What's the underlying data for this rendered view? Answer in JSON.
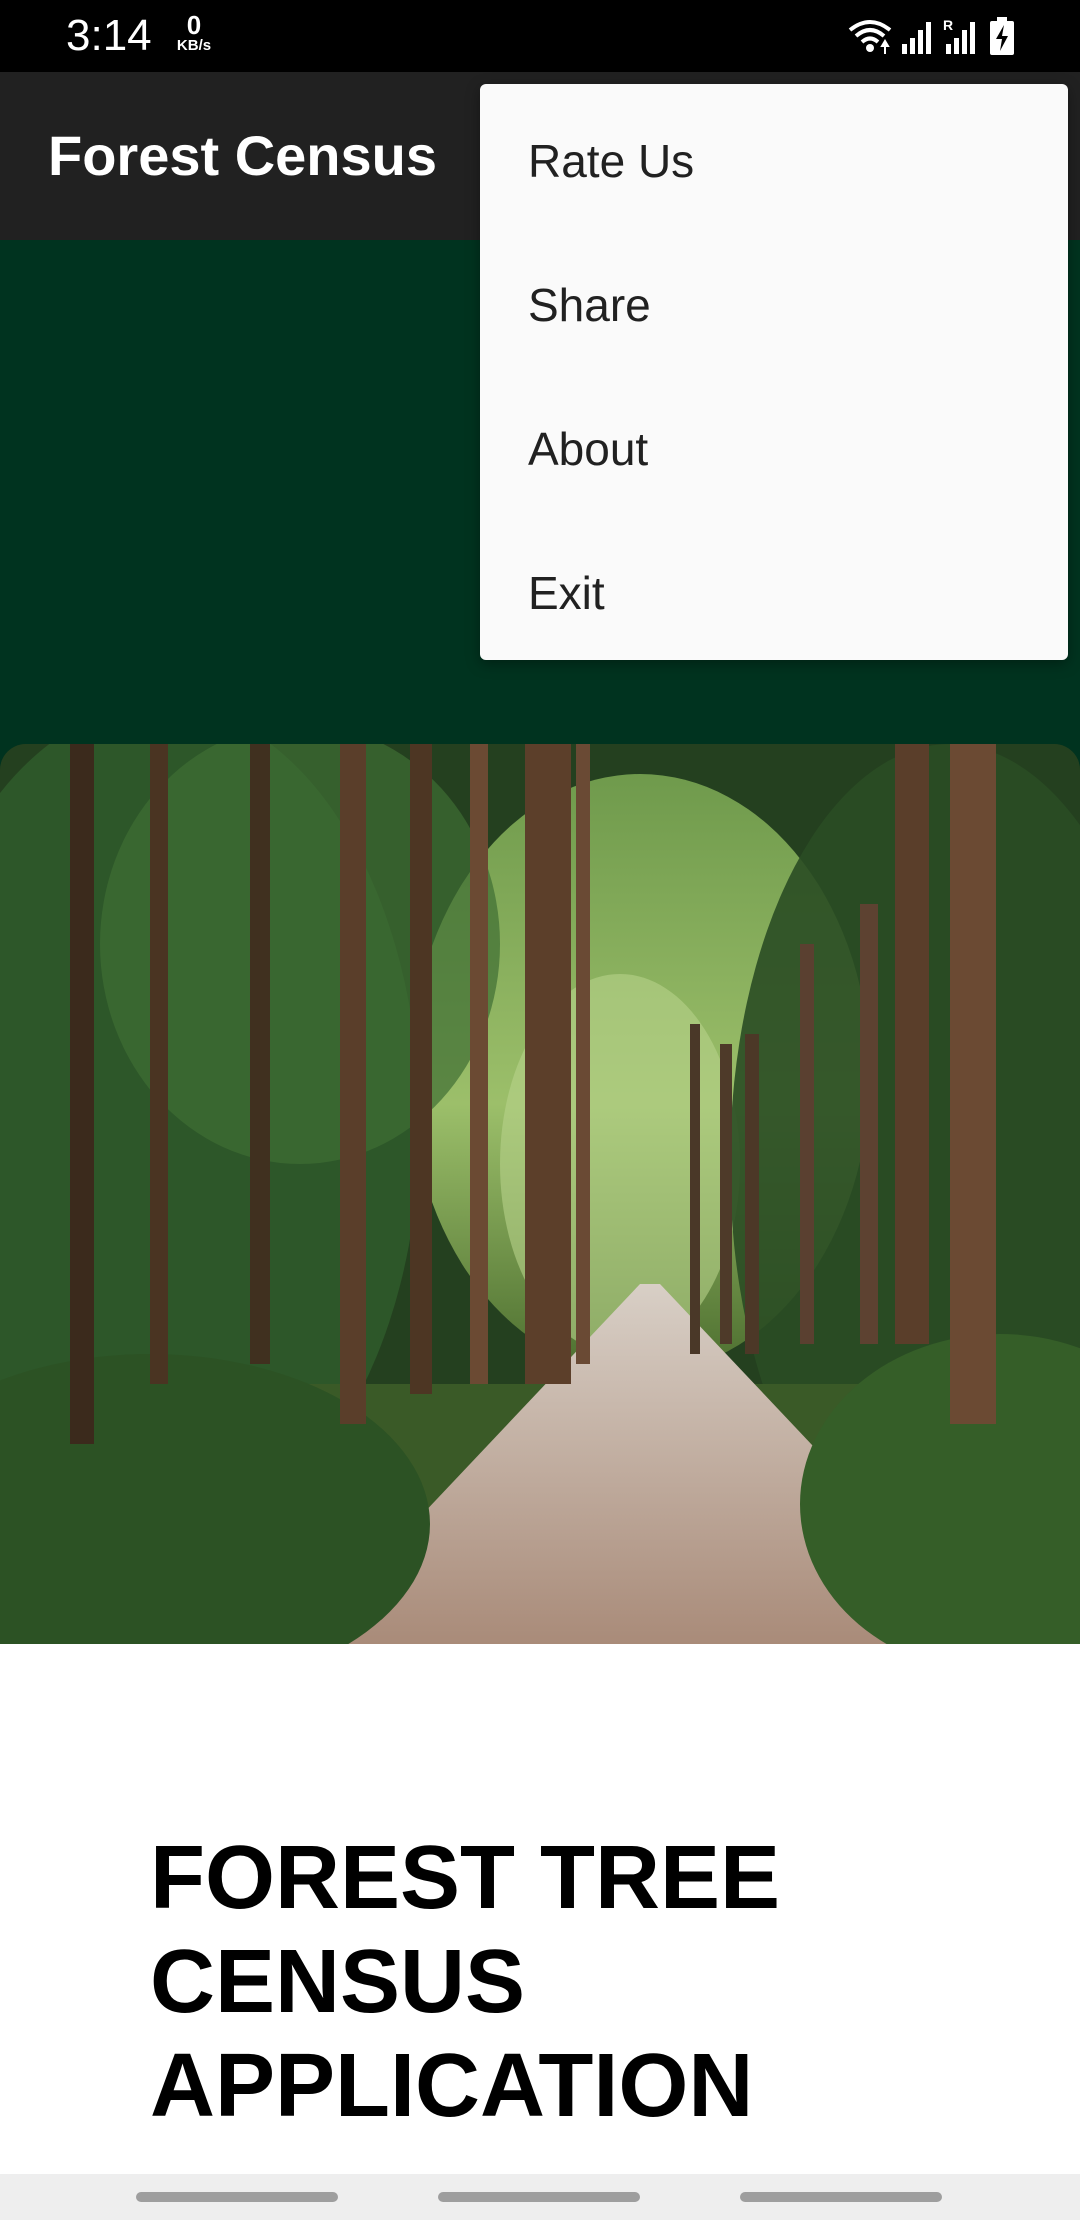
{
  "status_bar": {
    "time": "3:14",
    "net_speed_value": "0",
    "net_speed_unit": "KB/s",
    "icons": [
      "wifi-icon",
      "signal-icon",
      "signal-roaming-icon",
      "battery-charging-icon"
    ],
    "roaming_label": "R"
  },
  "app_bar": {
    "title": "Forest Census"
  },
  "overflow_menu": {
    "items": [
      {
        "label": "Rate Us"
      },
      {
        "label": "Share"
      },
      {
        "label": "About"
      },
      {
        "label": "Exit"
      }
    ]
  },
  "hero_image": {
    "subject": "forest-path-photo"
  },
  "main": {
    "heading_lines": [
      "FOREST TREE",
      "CENSUS",
      "APPLICATION"
    ]
  },
  "colors": {
    "status_bar": "#000000",
    "app_bar": "#212121",
    "banner": "#00331f",
    "menu_background": "#fafafa"
  }
}
